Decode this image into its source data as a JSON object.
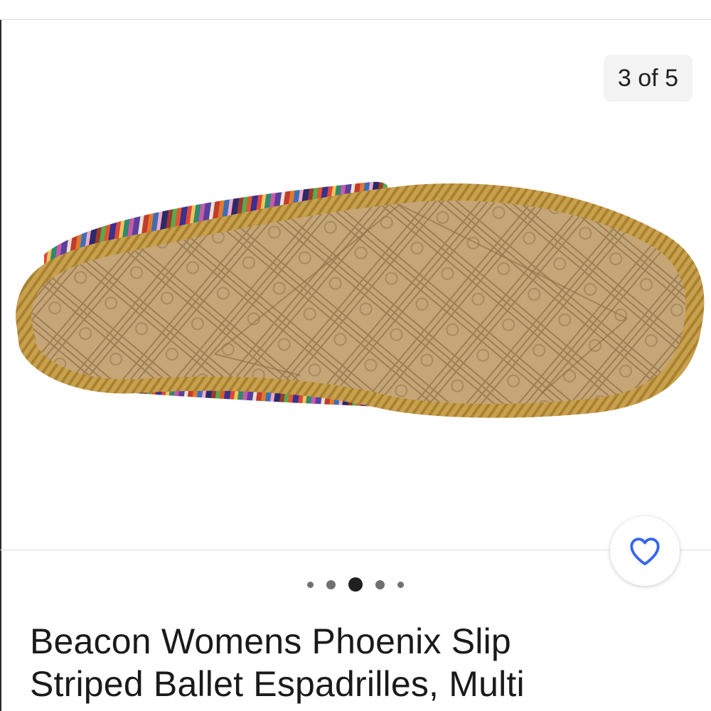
{
  "gallery": {
    "counter_text": "3 of 5",
    "image_subject": "espadrille-sole-photo",
    "total_images": 5,
    "current_index": 3
  },
  "watch_button": {
    "icon": "heart-outline-icon",
    "color": "#3665f3"
  },
  "listing": {
    "title_line1": "Beacon Womens Phoenix Slip",
    "title_line2": "Striped Ballet Espadrilles, Multi"
  },
  "colors": {
    "accent": "#3665f3",
    "text": "#1a1a1a",
    "jute": "#c9a04e",
    "sole": "#c4a175"
  }
}
